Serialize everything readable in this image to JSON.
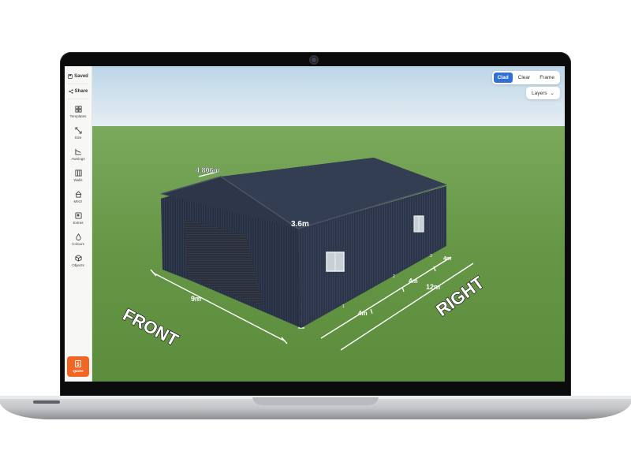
{
  "sidebar": {
    "saved_label": "Saved",
    "share_label": "Share",
    "items": [
      {
        "label": "Templates",
        "icon": "grid-icon"
      },
      {
        "label": "Size",
        "icon": "resize-icon"
      },
      {
        "label": "Awnings",
        "icon": "awning-icon"
      },
      {
        "label": "Walls",
        "icon": "walls-icon"
      },
      {
        "label": "Mezz",
        "icon": "house-icon"
      },
      {
        "label": "Extras",
        "icon": "extras-icon"
      },
      {
        "label": "Colours",
        "icon": "droplet-icon"
      },
      {
        "label": "Objects",
        "icon": "cube-icon"
      }
    ],
    "quote_label": "Quote"
  },
  "view_modes": {
    "clad": "Clad",
    "clear": "Clear",
    "frame": "Frame",
    "active": "Clad"
  },
  "layers_label": "Layers",
  "dimensions": {
    "roof_width": "4.806m",
    "height": "3.6m",
    "front_width": "9m",
    "bay1": "4m",
    "bay2": "4m",
    "bay3": "4m",
    "total_length": "12m",
    "bay_numbers": [
      "1",
      "2",
      "3"
    ]
  },
  "ground_labels": {
    "front": "FRONT",
    "right": "RIGHT"
  },
  "colors": {
    "accent": "#2f6fd6",
    "quote": "#f26522",
    "shed": "#2b3446",
    "grass": "#6a9c47"
  }
}
